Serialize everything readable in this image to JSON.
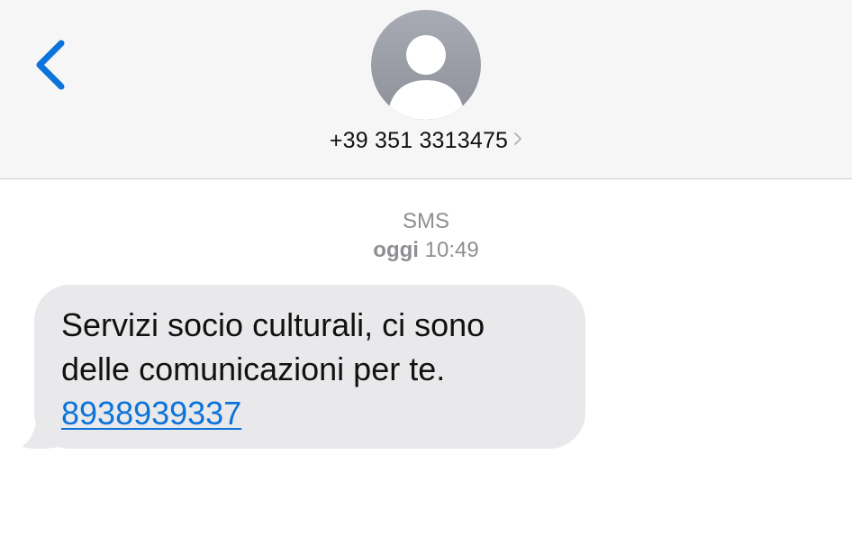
{
  "header": {
    "back_icon": "chevron-left-icon",
    "avatar_icon": "person-icon",
    "contact_number": "+39 351 3313475",
    "contact_chevron": "chevron-right-icon"
  },
  "thread": {
    "service": "SMS",
    "time_day": "oggi",
    "time_clock": "10:49"
  },
  "message": {
    "line1": "Servizi socio culturali, ci sono",
    "line2": "delle comunicazioni per te.",
    "link": "8938939337"
  },
  "colors": {
    "accent": "#0b73d9",
    "bubble": "#e9e9eb",
    "header_bg": "#f6f6f6",
    "meta_text": "#8e8e93"
  }
}
